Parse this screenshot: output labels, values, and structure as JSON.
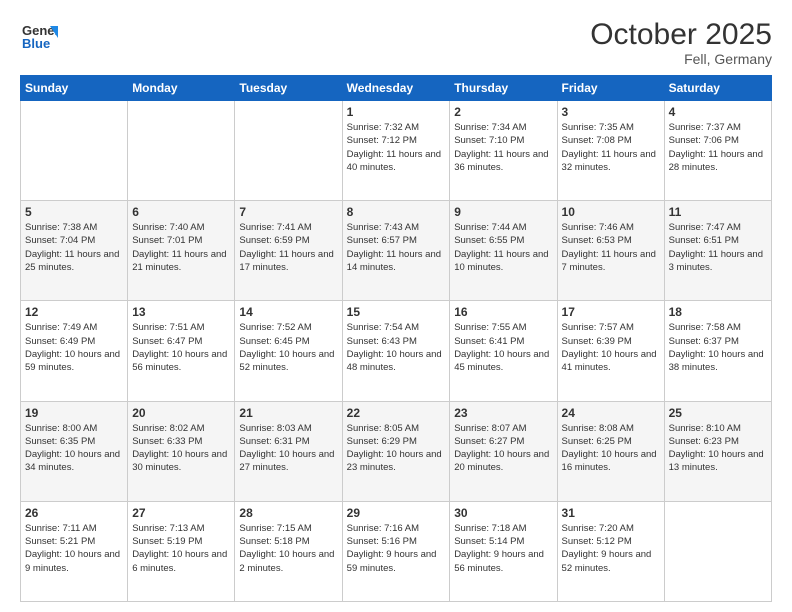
{
  "header": {
    "logo_general": "General",
    "logo_blue": "Blue",
    "month_title": "October 2025",
    "location": "Fell, Germany"
  },
  "weekdays": [
    "Sunday",
    "Monday",
    "Tuesday",
    "Wednesday",
    "Thursday",
    "Friday",
    "Saturday"
  ],
  "weeks": [
    [
      {
        "day": "",
        "info": ""
      },
      {
        "day": "",
        "info": ""
      },
      {
        "day": "",
        "info": ""
      },
      {
        "day": "1",
        "info": "Sunrise: 7:32 AM\nSunset: 7:12 PM\nDaylight: 11 hours\nand 40 minutes."
      },
      {
        "day": "2",
        "info": "Sunrise: 7:34 AM\nSunset: 7:10 PM\nDaylight: 11 hours\nand 36 minutes."
      },
      {
        "day": "3",
        "info": "Sunrise: 7:35 AM\nSunset: 7:08 PM\nDaylight: 11 hours\nand 32 minutes."
      },
      {
        "day": "4",
        "info": "Sunrise: 7:37 AM\nSunset: 7:06 PM\nDaylight: 11 hours\nand 28 minutes."
      }
    ],
    [
      {
        "day": "5",
        "info": "Sunrise: 7:38 AM\nSunset: 7:04 PM\nDaylight: 11 hours\nand 25 minutes."
      },
      {
        "day": "6",
        "info": "Sunrise: 7:40 AM\nSunset: 7:01 PM\nDaylight: 11 hours\nand 21 minutes."
      },
      {
        "day": "7",
        "info": "Sunrise: 7:41 AM\nSunset: 6:59 PM\nDaylight: 11 hours\nand 17 minutes."
      },
      {
        "day": "8",
        "info": "Sunrise: 7:43 AM\nSunset: 6:57 PM\nDaylight: 11 hours\nand 14 minutes."
      },
      {
        "day": "9",
        "info": "Sunrise: 7:44 AM\nSunset: 6:55 PM\nDaylight: 11 hours\nand 10 minutes."
      },
      {
        "day": "10",
        "info": "Sunrise: 7:46 AM\nSunset: 6:53 PM\nDaylight: 11 hours\nand 7 minutes."
      },
      {
        "day": "11",
        "info": "Sunrise: 7:47 AM\nSunset: 6:51 PM\nDaylight: 11 hours\nand 3 minutes."
      }
    ],
    [
      {
        "day": "12",
        "info": "Sunrise: 7:49 AM\nSunset: 6:49 PM\nDaylight: 10 hours\nand 59 minutes."
      },
      {
        "day": "13",
        "info": "Sunrise: 7:51 AM\nSunset: 6:47 PM\nDaylight: 10 hours\nand 56 minutes."
      },
      {
        "day": "14",
        "info": "Sunrise: 7:52 AM\nSunset: 6:45 PM\nDaylight: 10 hours\nand 52 minutes."
      },
      {
        "day": "15",
        "info": "Sunrise: 7:54 AM\nSunset: 6:43 PM\nDaylight: 10 hours\nand 48 minutes."
      },
      {
        "day": "16",
        "info": "Sunrise: 7:55 AM\nSunset: 6:41 PM\nDaylight: 10 hours\nand 45 minutes."
      },
      {
        "day": "17",
        "info": "Sunrise: 7:57 AM\nSunset: 6:39 PM\nDaylight: 10 hours\nand 41 minutes."
      },
      {
        "day": "18",
        "info": "Sunrise: 7:58 AM\nSunset: 6:37 PM\nDaylight: 10 hours\nand 38 minutes."
      }
    ],
    [
      {
        "day": "19",
        "info": "Sunrise: 8:00 AM\nSunset: 6:35 PM\nDaylight: 10 hours\nand 34 minutes."
      },
      {
        "day": "20",
        "info": "Sunrise: 8:02 AM\nSunset: 6:33 PM\nDaylight: 10 hours\nand 30 minutes."
      },
      {
        "day": "21",
        "info": "Sunrise: 8:03 AM\nSunset: 6:31 PM\nDaylight: 10 hours\nand 27 minutes."
      },
      {
        "day": "22",
        "info": "Sunrise: 8:05 AM\nSunset: 6:29 PM\nDaylight: 10 hours\nand 23 minutes."
      },
      {
        "day": "23",
        "info": "Sunrise: 8:07 AM\nSunset: 6:27 PM\nDaylight: 10 hours\nand 20 minutes."
      },
      {
        "day": "24",
        "info": "Sunrise: 8:08 AM\nSunset: 6:25 PM\nDaylight: 10 hours\nand 16 minutes."
      },
      {
        "day": "25",
        "info": "Sunrise: 8:10 AM\nSunset: 6:23 PM\nDaylight: 10 hours\nand 13 minutes."
      }
    ],
    [
      {
        "day": "26",
        "info": "Sunrise: 7:11 AM\nSunset: 5:21 PM\nDaylight: 10 hours\nand 9 minutes."
      },
      {
        "day": "27",
        "info": "Sunrise: 7:13 AM\nSunset: 5:19 PM\nDaylight: 10 hours\nand 6 minutes."
      },
      {
        "day": "28",
        "info": "Sunrise: 7:15 AM\nSunset: 5:18 PM\nDaylight: 10 hours\nand 2 minutes."
      },
      {
        "day": "29",
        "info": "Sunrise: 7:16 AM\nSunset: 5:16 PM\nDaylight: 9 hours\nand 59 minutes."
      },
      {
        "day": "30",
        "info": "Sunrise: 7:18 AM\nSunset: 5:14 PM\nDaylight: 9 hours\nand 56 minutes."
      },
      {
        "day": "31",
        "info": "Sunrise: 7:20 AM\nSunset: 5:12 PM\nDaylight: 9 hours\nand 52 minutes."
      },
      {
        "day": "",
        "info": ""
      }
    ]
  ]
}
